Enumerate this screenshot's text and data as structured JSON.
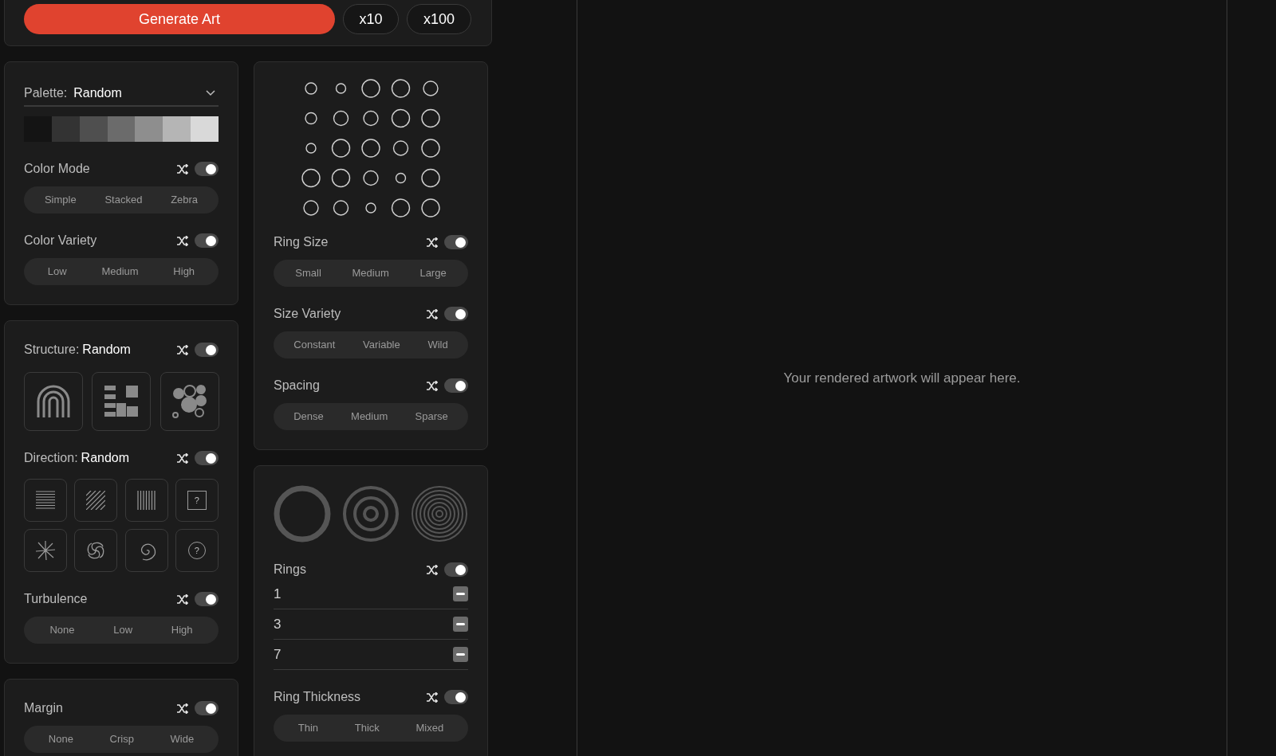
{
  "actions": {
    "generate": "Generate Art",
    "batch": [
      "x10",
      "x100"
    ]
  },
  "left_column": [
    {
      "items": [
        {
          "kind": "palette",
          "label": "Palette:",
          "value": "Random",
          "swatches": [
            {
              "color": "#141414"
            },
            {
              "color": "#333333"
            },
            {
              "color": "#4f4f4f"
            },
            {
              "color": "#6b6b6b"
            },
            {
              "color": "#8e8e8e"
            },
            {
              "color": "#b5b5b5"
            },
            {
              "color": "#d9d9d9"
            }
          ]
        },
        {
          "kind": "segmented",
          "label": "Color Mode",
          "toggle_on": true,
          "options": [
            "Simple",
            "Stacked",
            "Zebra"
          ]
        },
        {
          "kind": "segmented",
          "label": "Color Variety",
          "toggle_on": true,
          "options": [
            "Low",
            "Medium",
            "High"
          ]
        }
      ]
    },
    {
      "items": [
        {
          "kind": "large_tiles",
          "label": "Structure:",
          "value": "Random",
          "toggle_on": true,
          "tiles": [
            {
              "kind": "arch"
            },
            {
              "kind": "blocks"
            },
            {
              "kind": "bubbles"
            }
          ]
        },
        {
          "kind": "small_tiles",
          "label": "Direction:",
          "value": "Random",
          "toggle_on": true,
          "tiles": [
            {
              "kind": "horizontal"
            },
            {
              "kind": "diagonal"
            },
            {
              "kind": "vertical"
            },
            {
              "kind": "random_square",
              "glyph": "?"
            },
            {
              "kind": "radial"
            },
            {
              "kind": "swirl"
            },
            {
              "kind": "spiral"
            },
            {
              "kind": "random_circle",
              "glyph": "?"
            }
          ]
        },
        {
          "kind": "segmented",
          "label": "Turbulence",
          "toggle_on": true,
          "options": [
            "None",
            "Low",
            "High"
          ]
        }
      ]
    },
    {
      "items": [
        {
          "kind": "segmented",
          "label": "Margin",
          "toggle_on": true,
          "options": [
            "None",
            "Crisp",
            "Wide"
          ]
        }
      ]
    }
  ],
  "right_column": [
    {
      "items": [
        {
          "kind": "ring_grid"
        },
        {
          "kind": "segmented",
          "label": "Ring Size",
          "toggle_on": true,
          "options": [
            "Small",
            "Medium",
            "Large"
          ]
        },
        {
          "kind": "segmented",
          "label": "Size Variety",
          "toggle_on": true,
          "options": [
            "Constant",
            "Variable",
            "Wild"
          ]
        },
        {
          "kind": "segmented",
          "label": "Spacing",
          "toggle_on": true,
          "options": [
            "Dense",
            "Medium",
            "Sparse"
          ]
        }
      ]
    },
    {
      "items": [
        {
          "kind": "ring_previews"
        },
        {
          "kind": "list",
          "label": "Rings",
          "toggle_on": true,
          "values": [
            "1",
            "3",
            "7"
          ]
        },
        {
          "kind": "segmented",
          "label": "Ring Thickness",
          "toggle_on": true,
          "options": [
            "Thin",
            "Thick",
            "Mixed"
          ]
        }
      ]
    }
  ],
  "preview": {
    "message": "Your rendered artwork will appear here."
  }
}
